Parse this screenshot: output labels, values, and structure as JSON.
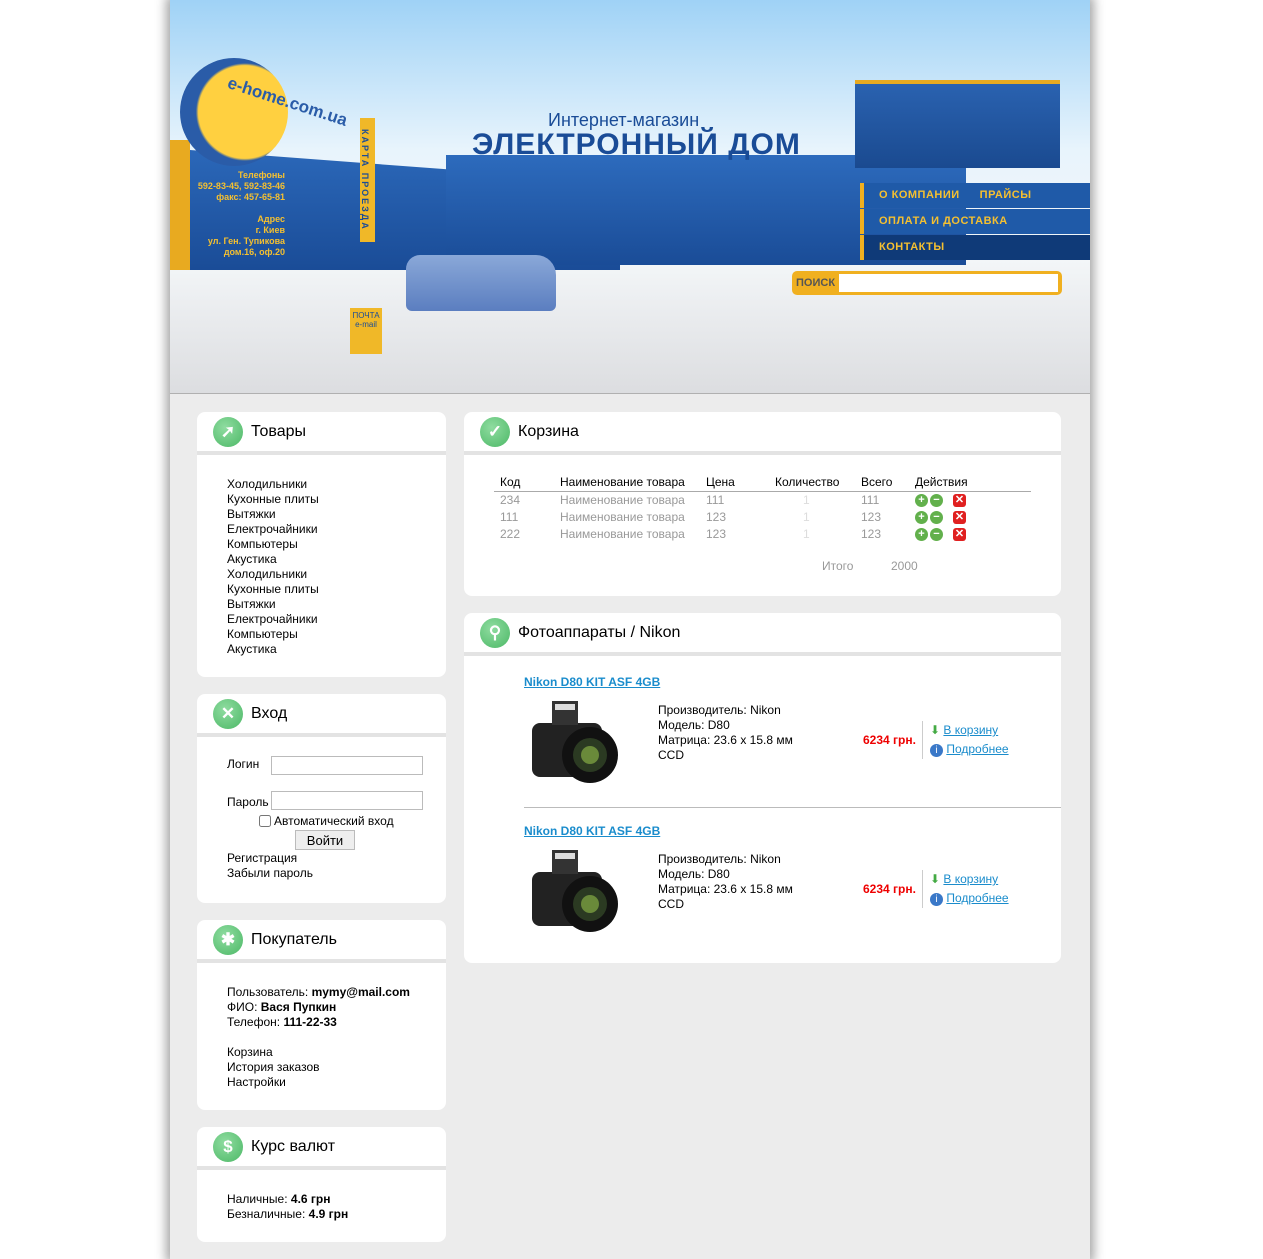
{
  "header": {
    "logo": "e-home.com.ua",
    "phones_label": "Телефоны",
    "phones": "592-83-45, 592-83-46",
    "fax": "факс: 457-65-81",
    "address_label": "Адрес",
    "city": "г. Киев",
    "street": "ул. Ген. Тупикова",
    "house": "дом.16, оф.20",
    "map_sign": "КАРТА ПРОЕЗДА",
    "mail_sign": "ПОЧТА",
    "mail_sign2": "e-mail",
    "subtitle": "Интернет-магазин",
    "title": "ЭЛЕКТРОННЫЙ ДОМ",
    "menu": [
      "О КОМПАНИИ",
      "ПРАЙСЫ",
      "ОПЛАТА И ДОСТАВКА",
      "КОНТАКТЫ"
    ],
    "search_label": "ПОИСК",
    "search_value": ""
  },
  "goods": {
    "title": "Товары",
    "items": [
      "Холодильники",
      "Кухонные плиты",
      "Вытяжки",
      "Електрочайники",
      "Компьютеры",
      "Акустика",
      "Холодильники",
      "Кухонные плиты",
      "Вытяжки",
      "Електрочайники",
      "Компьютеры",
      "Акустика"
    ]
  },
  "login": {
    "title": "Вход",
    "login_label": "Логин",
    "password_label": "Пароль",
    "auto_label": "Автоматический вход",
    "auto_checked": false,
    "submit": "Войти",
    "register": "Регистрация",
    "forgot": "Забыли пароль"
  },
  "buyer": {
    "title": "Покупатель",
    "user_label": "Пользователь:",
    "user": "mymy@mail.com",
    "name_label": "ФИО:",
    "name": "Вася Пупкин",
    "phone_label": "Телефон:",
    "phone": "111-22-33",
    "links": [
      "Корзина",
      "История заказов",
      "Настройки"
    ]
  },
  "currency": {
    "title": "Курс валют",
    "cash_label": "Наличные:",
    "cash": "4.6 грн",
    "noncash_label": "Безналичные:",
    "noncash": "4.9 грн"
  },
  "cart": {
    "title": "Корзина",
    "columns": [
      "Код",
      "Наименование товара",
      "Цена",
      "Количество",
      "Всего",
      "Действия"
    ],
    "rows": [
      {
        "code": "234",
        "name": "Наименование товара",
        "price": "111",
        "qty": "1",
        "total": "111"
      },
      {
        "code": "111",
        "name": "Наименование товара",
        "price": "123",
        "qty": "1",
        "total": "123"
      },
      {
        "code": "222",
        "name": "Наименование товара",
        "price": "123",
        "qty": "1",
        "total": "123"
      }
    ],
    "total_label": "Итого",
    "total": "2000"
  },
  "catalog": {
    "title": "Фотоаппараты / Nikon",
    "products": [
      {
        "name": "Nikon D80 KIT ASF 4GB",
        "maker": "Производитель: Nikon",
        "model": "Модель: D80",
        "matrix": "Матрица: 23.6 x 15.8 мм",
        "sensor": "CCD",
        "price": "6234 грн.",
        "cart": "В корзину",
        "more": "Подробнее"
      },
      {
        "name": "Nikon D80 KIT ASF 4GB",
        "maker": "Производитель: Nikon",
        "model": "Модель: D80",
        "matrix": "Матрица: 23.6 x 15.8 мм",
        "sensor": "CCD",
        "price": "6234 грн.",
        "cart": "В корзину",
        "more": "Подробнее"
      }
    ]
  }
}
